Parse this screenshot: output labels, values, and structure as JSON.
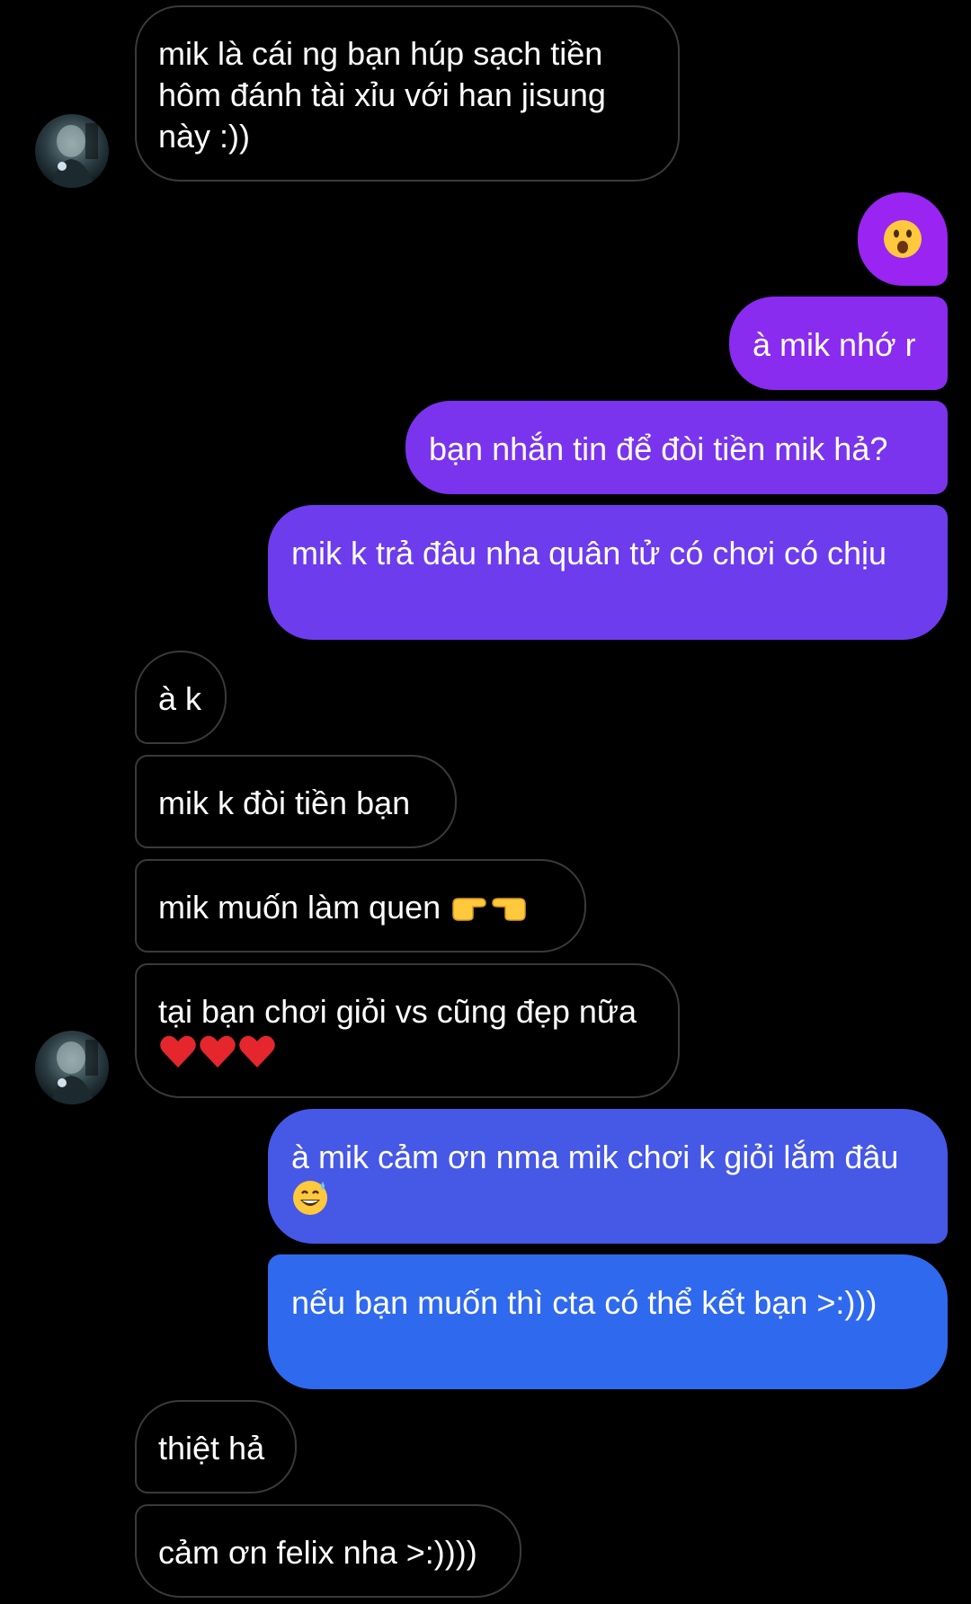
{
  "messages": [
    {
      "side": "in",
      "text": "mik là cái ng bạn húp sạch tiền hôm đánh tài xỉu với han jisung này :))"
    },
    {
      "side": "out",
      "emoji": "astonished-face"
    },
    {
      "side": "out",
      "text": "à mik nhớ r"
    },
    {
      "side": "out",
      "text": "bạn nhắn tin để đòi tiền mik hả?"
    },
    {
      "side": "out",
      "text": "mik k trả đâu nha quân tử có chơi có chịu"
    },
    {
      "side": "in",
      "text": "à k"
    },
    {
      "side": "in",
      "text": "mik k đòi tiền bạn"
    },
    {
      "side": "in",
      "text": "mik muốn làm quen",
      "emojis": [
        "pointing-right-icon",
        "pointing-left-icon"
      ]
    },
    {
      "side": "in",
      "text": "tại bạn chơi giỏi vs cũng đẹp nữa",
      "emojis": [
        "red-heart-icon",
        "red-heart-icon",
        "red-heart-icon"
      ]
    },
    {
      "side": "out",
      "text": "à mik cảm ơn nma mik chơi k giỏi lắm đâu",
      "emojis": [
        "grinning-sweat-icon"
      ]
    },
    {
      "side": "out",
      "text": "nếu bạn muốn thì cta có thể kết bạn >:)))"
    },
    {
      "side": "in",
      "text": "thiệt hả"
    },
    {
      "side": "in",
      "text": "cảm ơn felix nha >:))))"
    }
  ],
  "colors": {
    "background": "#000000",
    "incoming_border": "#3a3a3c",
    "outgoing_gradient": [
      "#9a24f2",
      "#8a2bf0",
      "#7a34ee",
      "#6d3ced",
      "#4658e6",
      "#2f69ee"
    ]
  }
}
